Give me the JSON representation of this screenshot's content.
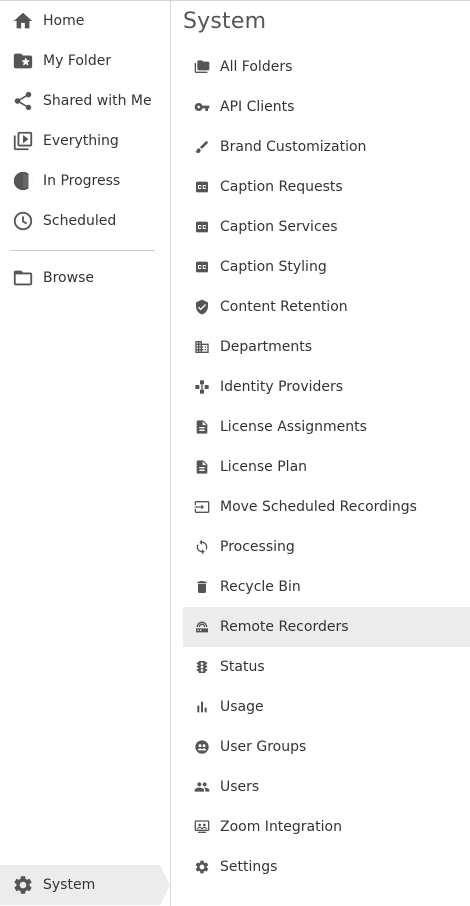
{
  "sidebar": {
    "items": [
      {
        "label": "Home",
        "icon": "home-icon"
      },
      {
        "label": "My Folder",
        "icon": "folder-star-icon"
      },
      {
        "label": "Shared with Me",
        "icon": "share-icon"
      },
      {
        "label": "Everything",
        "icon": "video-library-icon"
      },
      {
        "label": "In Progress",
        "icon": "in-progress-icon"
      },
      {
        "label": "Scheduled",
        "icon": "clock-icon"
      }
    ],
    "browse": {
      "label": "Browse",
      "icon": "folder-outline-icon"
    },
    "system": {
      "label": "System",
      "icon": "gear-icon"
    }
  },
  "main": {
    "title": "System",
    "menu": [
      {
        "label": "All Folders",
        "icon": "folders-icon"
      },
      {
        "label": "API Clients",
        "icon": "key-icon"
      },
      {
        "label": "Brand Customization",
        "icon": "brush-icon"
      },
      {
        "label": "Caption Requests",
        "icon": "closed-caption-icon"
      },
      {
        "label": "Caption Services",
        "icon": "closed-caption-icon"
      },
      {
        "label": "Caption Styling",
        "icon": "closed-caption-icon"
      },
      {
        "label": "Content Retention",
        "icon": "shield-check-icon"
      },
      {
        "label": "Departments",
        "icon": "building-icon"
      },
      {
        "label": "Identity Providers",
        "icon": "identity-providers-icon"
      },
      {
        "label": "License Assignments",
        "icon": "document-icon"
      },
      {
        "label": "License Plan",
        "icon": "document-icon"
      },
      {
        "label": "Move Scheduled Recordings",
        "icon": "move-icon"
      },
      {
        "label": "Processing",
        "icon": "sync-icon"
      },
      {
        "label": "Recycle Bin",
        "icon": "trash-icon"
      },
      {
        "label": "Remote Recorders",
        "icon": "router-icon",
        "active": true
      },
      {
        "label": "Status",
        "icon": "traffic-light-icon"
      },
      {
        "label": "Usage",
        "icon": "bar-chart-icon"
      },
      {
        "label": "User Groups",
        "icon": "user-groups-icon"
      },
      {
        "label": "Users",
        "icon": "users-icon"
      },
      {
        "label": "Zoom Integration",
        "icon": "zoom-icon"
      },
      {
        "label": "Settings",
        "icon": "gear-icon"
      }
    ]
  },
  "colors": {
    "icon": "#555555",
    "text": "#333333",
    "active_bg": "#ececec",
    "divider": "#cccccc"
  }
}
